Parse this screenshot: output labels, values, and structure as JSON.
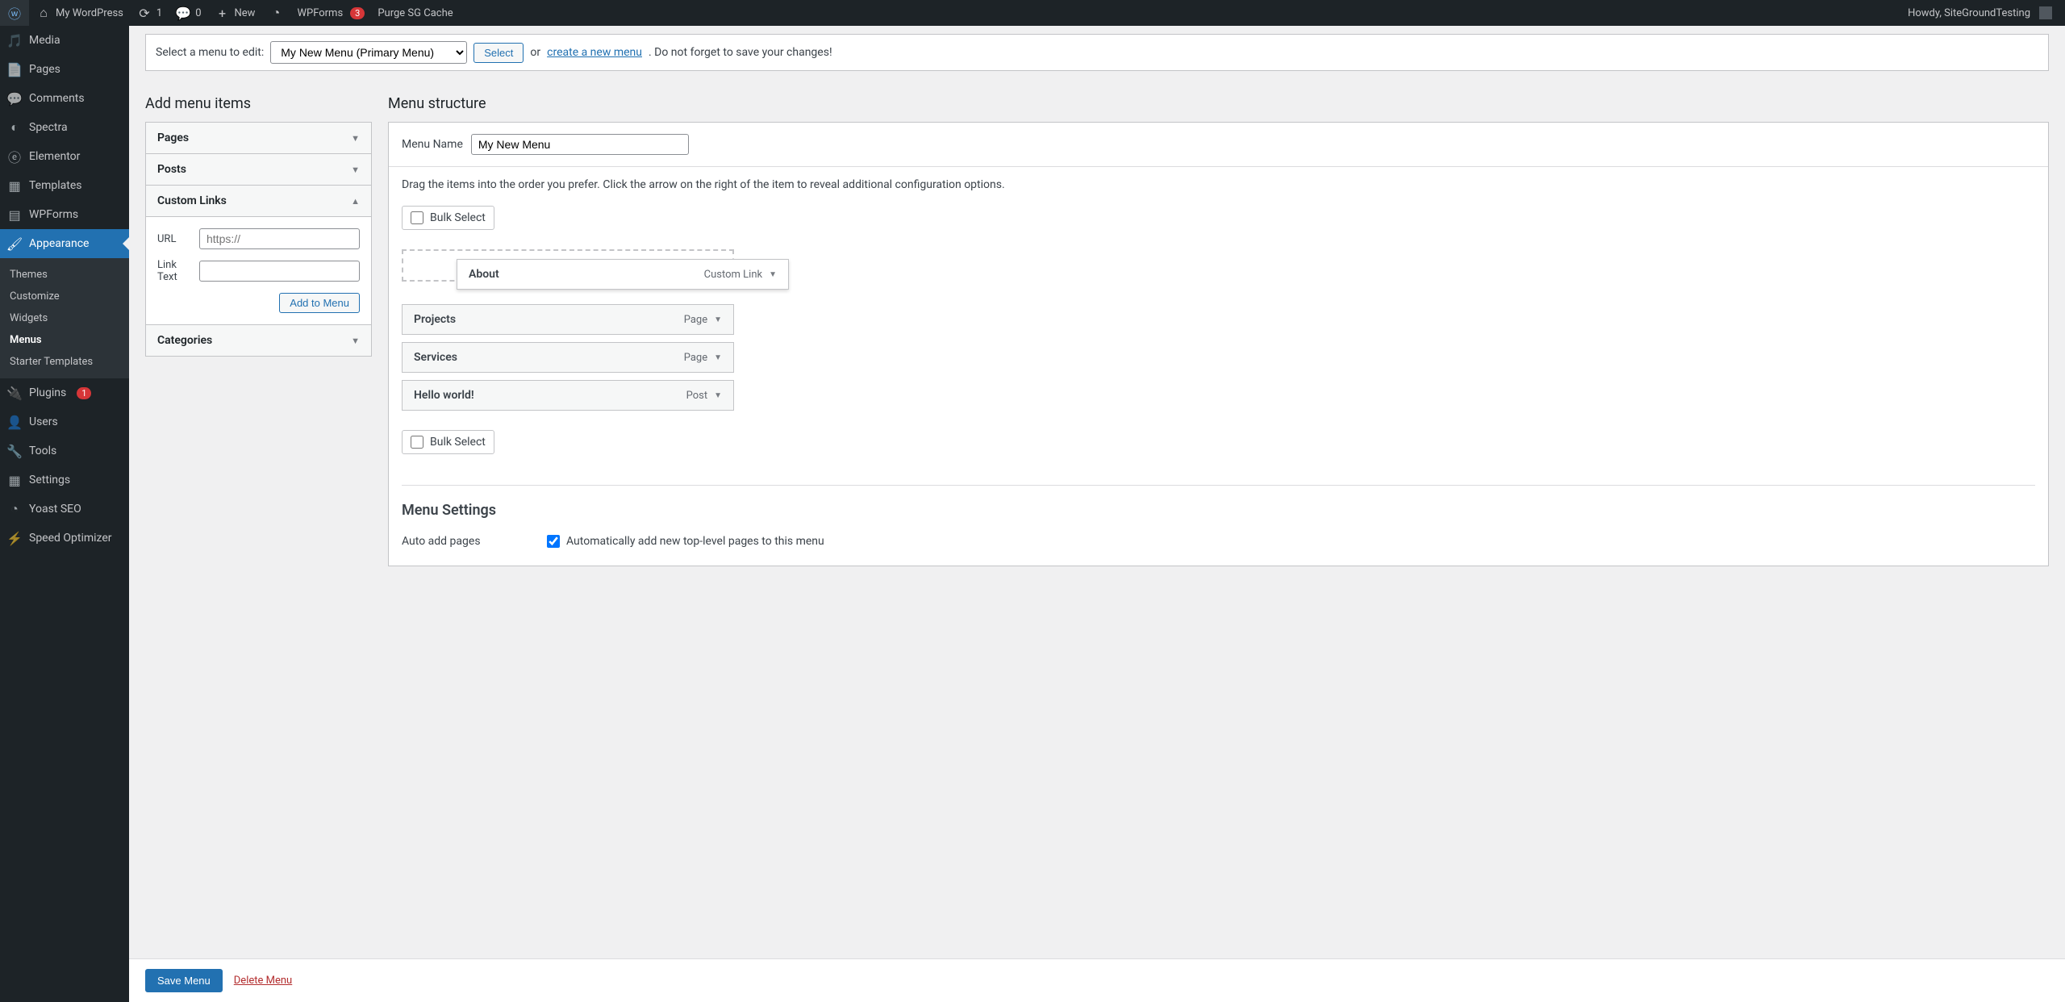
{
  "adminbar": {
    "site_name": "My WordPress",
    "updates": "1",
    "comments": "0",
    "new_label": "New",
    "wpforms_label": "WPForms",
    "wpforms_badge": "3",
    "purge_label": "Purge SG Cache",
    "howdy": "Howdy, SiteGroundTesting"
  },
  "sidebar": {
    "media": "Media",
    "pages": "Pages",
    "comments": "Comments",
    "spectra": "Spectra",
    "elementor": "Elementor",
    "templates": "Templates",
    "wpforms": "WPForms",
    "appearance": "Appearance",
    "appearance_sub": {
      "themes": "Themes",
      "customize": "Customize",
      "widgets": "Widgets",
      "menus": "Menus",
      "starter": "Starter Templates"
    },
    "plugins": "Plugins",
    "plugins_badge": "1",
    "users": "Users",
    "tools": "Tools",
    "settings": "Settings",
    "yoast": "Yoast SEO",
    "speed": "Speed Optimizer"
  },
  "menu_select": {
    "label": "Select a menu to edit:",
    "selected": "My New Menu (Primary Menu)",
    "select_btn": "Select",
    "or": "or ",
    "create_link": "create a new menu",
    "save_hint": ". Do not forget to save your changes!"
  },
  "add_items": {
    "heading": "Add menu items",
    "pages": "Pages",
    "posts": "Posts",
    "custom_links": "Custom Links",
    "url_label": "URL",
    "url_placeholder": "https://",
    "linktext_label": "Link Text",
    "add_btn": "Add to Menu",
    "categories": "Categories"
  },
  "structure": {
    "heading": "Menu structure",
    "name_label": "Menu Name",
    "name_value": "My New Menu",
    "instructions": "Drag the items into the order you prefer. Click the arrow on the right of the item to reveal additional configuration options.",
    "bulk_select": "Bulk Select",
    "items": [
      {
        "title": "About",
        "type": "Custom Link"
      },
      {
        "title": "Projects",
        "type": "Page"
      },
      {
        "title": "Services",
        "type": "Page"
      },
      {
        "title": "Hello world!",
        "type": "Post"
      }
    ],
    "settings_heading": "Menu Settings",
    "auto_add_label": "Auto add pages",
    "auto_add_check": "Automatically add new top-level pages to this menu"
  },
  "bottom": {
    "save": "Save Menu",
    "delete": "Delete Menu"
  }
}
